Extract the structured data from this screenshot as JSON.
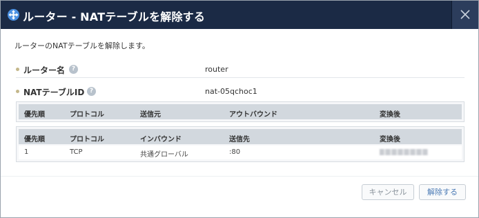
{
  "dialog": {
    "title": "ルーター - NATテーブルを解除する",
    "close_icon": "close-icon",
    "title_icon": "crosshair-plus-icon",
    "colors": {
      "titlebar": "#1b2a45",
      "icon_accent": "#4a90e2"
    }
  },
  "description": "ルーターのNATテーブルを解除します。",
  "fields": {
    "router": {
      "label": "ルーター名",
      "help": "?",
      "value": "router"
    },
    "nat_id": {
      "label": "NATテーブルID",
      "help": "?",
      "value": "nat-05qchoc1"
    }
  },
  "outbound_table": {
    "headers": [
      "優先順",
      "プロトコル",
      "送信元",
      "アウトバウンド",
      "変換後"
    ],
    "rows": []
  },
  "inbound_table": {
    "headers": [
      "優先順",
      "プロトコル",
      "インバウンド",
      "送信先",
      "変換後"
    ],
    "rows": [
      [
        "1",
        "TCP",
        "共通グローバル",
        ":80",
        "[blurred]"
      ]
    ]
  },
  "buttons": {
    "cancel": "キャンセル",
    "release": "解除する"
  }
}
